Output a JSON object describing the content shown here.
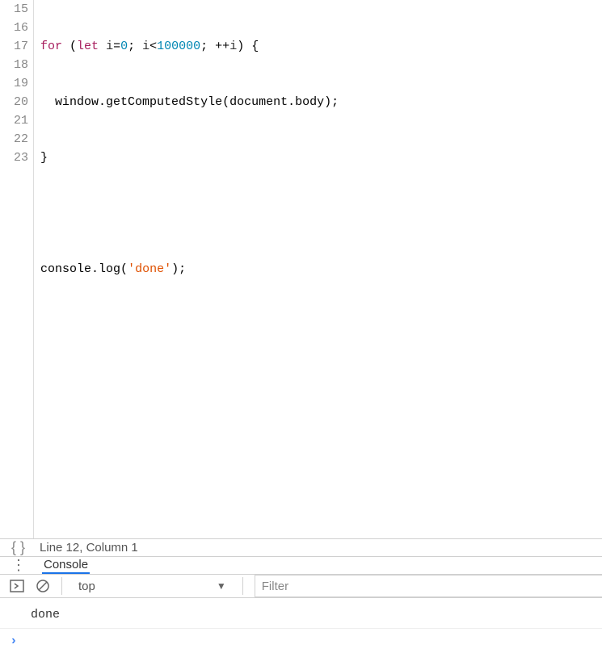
{
  "editor": {
    "line_numbers": [
      "15",
      "16",
      "17",
      "18",
      "19",
      "20",
      "21",
      "22",
      "23"
    ],
    "code": {
      "line15": {
        "kw_for": "for",
        "paren_open": " (",
        "kw_let": "let",
        "sp1": " ",
        "var_i1": "i",
        "eq": "=",
        "num0": "0",
        "semi1": "; ",
        "var_i2": "i",
        "lt": "<",
        "num_big": "100000",
        "semi2": "; ++",
        "var_i3": "i",
        "paren_close": ") {"
      },
      "line16": {
        "indent": "  ",
        "obj1": "window",
        "dot1": ".",
        "fn1": "getComputedStyle",
        "args": "(document.body);"
      },
      "line17": {
        "brace": "}"
      },
      "line19": {
        "obj": "console",
        "dot": ".",
        "fn": "log",
        "paren_open": "(",
        "str": "'done'",
        "paren_close": ");"
      }
    }
  },
  "status": {
    "line_col": "Line 12, Column 1"
  },
  "console_tab": {
    "label": "Console"
  },
  "toolbar": {
    "context": "top"
  },
  "filter": {
    "placeholder": "Filter"
  },
  "output": {
    "line1": "done"
  }
}
